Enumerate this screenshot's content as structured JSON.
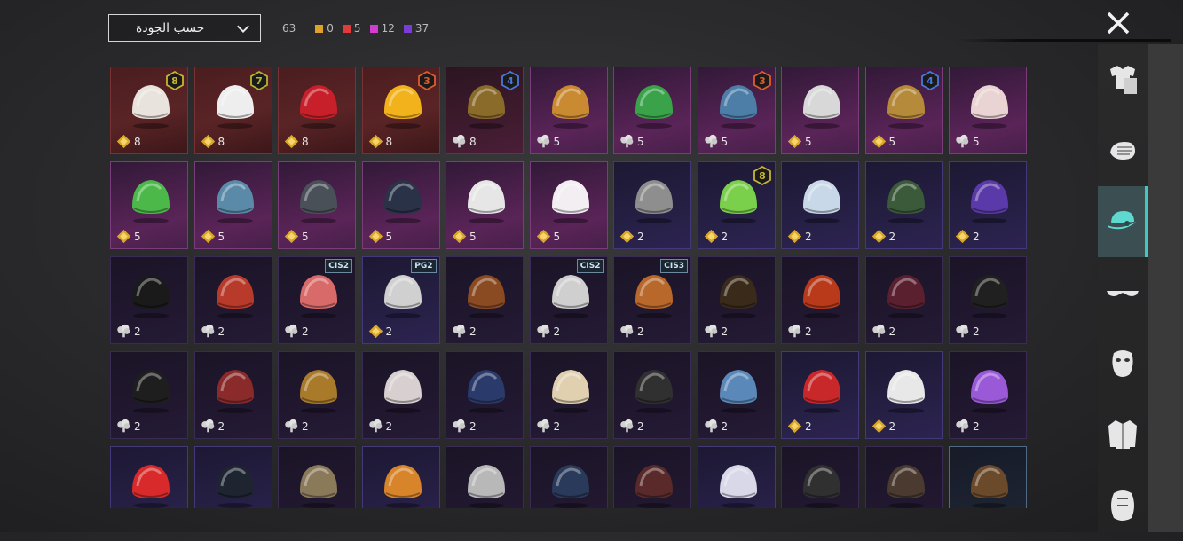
{
  "header": {
    "sort_label": "حسب الجودة",
    "total": "63",
    "stats": [
      {
        "color": "#e0a12a",
        "value": "0"
      },
      {
        "color": "#e03a3a",
        "value": "5"
      },
      {
        "color": "#d43cd0",
        "value": "12"
      },
      {
        "color": "#7a3cd8",
        "value": "37"
      }
    ]
  },
  "sidebar": {
    "items": [
      {
        "icon": "outfit-icon",
        "active": false
      },
      {
        "icon": "gloves-icon",
        "active": false
      },
      {
        "icon": "cap-icon",
        "active": true
      },
      {
        "icon": "glasses-icon",
        "active": false
      },
      {
        "icon": "mask-icon",
        "active": false
      },
      {
        "icon": "jacket-icon",
        "active": false
      },
      {
        "icon": "face-paint-icon",
        "active": false
      }
    ]
  },
  "items": [
    {
      "icon": "white-hair-icon",
      "count": "8",
      "currency": "gold",
      "rarity": "red",
      "badge": "8",
      "art": "#e8e3dc"
    },
    {
      "icon": "white-ponytail-icon",
      "count": "8",
      "currency": "gold",
      "rarity": "red",
      "badge": "7",
      "art": "#eeeeee"
    },
    {
      "icon": "red-helmet-icon",
      "count": "8",
      "currency": "gold",
      "rarity": "red",
      "art": "#c8202a"
    },
    {
      "icon": "fries-hat-icon",
      "count": "8",
      "currency": "gold",
      "rarity": "red",
      "badge": "3",
      "art": "#f2b21c"
    },
    {
      "icon": "gold-mask-helmet-icon",
      "count": "8",
      "currency": "silver",
      "rarity": "mix",
      "badge": "4",
      "art": "#8a6b2a"
    },
    {
      "icon": "fish-head-icon",
      "count": "5",
      "currency": "silver",
      "rarity": "pink",
      "art": "#c98a32"
    },
    {
      "icon": "green-demon-helmet-icon",
      "count": "5",
      "currency": "silver",
      "rarity": "pink",
      "art": "#3aa34a"
    },
    {
      "icon": "ufo-hat-icon",
      "count": "5",
      "currency": "silver",
      "rarity": "pink",
      "badge": "3",
      "art": "#4c7ea8"
    },
    {
      "icon": "robot-helmet-icon",
      "count": "5",
      "currency": "gold",
      "rarity": "pink",
      "art": "#d8d8d8"
    },
    {
      "icon": "samurai-mask-icon",
      "count": "5",
      "currency": "gold",
      "rarity": "pink",
      "badge": "4",
      "art": "#b58a3a"
    },
    {
      "icon": "skull-mask-icon",
      "count": "5",
      "currency": "silver",
      "rarity": "pink",
      "art": "#e9d3d3"
    },
    {
      "icon": "frog-hat-icon",
      "count": "5",
      "currency": "gold",
      "rarity": "pink",
      "art": "#4cb84a"
    },
    {
      "icon": "headband-icon",
      "count": "5",
      "currency": "gold",
      "rarity": "pink",
      "art": "#5a8aa8"
    },
    {
      "icon": "tactical-helmet-icon",
      "count": "5",
      "currency": "gold",
      "rarity": "pink",
      "art": "#4a5058"
    },
    {
      "icon": "cat-helmet-icon",
      "count": "5",
      "currency": "gold",
      "rarity": "pink",
      "art": "#2a3248"
    },
    {
      "icon": "beanie-icon",
      "count": "5",
      "currency": "gold",
      "rarity": "pink",
      "art": "#e6e6e6"
    },
    {
      "icon": "sun-hat-icon",
      "count": "5",
      "currency": "gold",
      "rarity": "pink",
      "art": "#f2eef2"
    },
    {
      "icon": "grey-wig-icon",
      "count": "2",
      "currency": "gold",
      "rarity": "purple",
      "art": "#8e8e8e"
    },
    {
      "icon": "green-skull-icon",
      "count": "2",
      "currency": "gold",
      "rarity": "purple",
      "badge": "8",
      "art": "#7ad04a"
    },
    {
      "icon": "baseball-cap-icon",
      "count": "2",
      "currency": "gold",
      "rarity": "purple",
      "art": "#c9d8e8"
    },
    {
      "icon": "gas-mask-helmet-icon",
      "count": "2",
      "currency": "gold",
      "rarity": "purple",
      "art": "#3a5a3a"
    },
    {
      "icon": "purple-helmet-icon",
      "count": "2",
      "currency": "gold",
      "rarity": "purple",
      "art": "#5a3aa8"
    },
    {
      "icon": "black-cap-icon",
      "count": "2",
      "currency": "silver",
      "rarity": "dark",
      "art": "#1a1a1a"
    },
    {
      "icon": "bucket-hat-icon",
      "count": "2",
      "currency": "silver",
      "rarity": "dark",
      "art": "#b83a2a"
    },
    {
      "icon": "knit-hat-icon",
      "count": "2",
      "currency": "silver",
      "rarity": "dark",
      "tag": "CIS2",
      "art": "#d86a6a"
    },
    {
      "icon": "silver-wig-icon",
      "count": "2",
      "currency": "gold",
      "rarity": "purple",
      "tag": "PG2",
      "art": "#d0d0d0"
    },
    {
      "icon": "brown-braids-icon",
      "count": "2",
      "currency": "silver",
      "rarity": "dark",
      "art": "#8a4a22"
    },
    {
      "icon": "chef-gas-mask-icon",
      "count": "2",
      "currency": "silver",
      "rarity": "dark",
      "tag": "CIS2",
      "art": "#cfcfcf"
    },
    {
      "icon": "steampunk-mask-icon",
      "count": "2",
      "currency": "silver",
      "rarity": "dark",
      "tag": "CIS3",
      "art": "#b8682a"
    },
    {
      "icon": "goggles-hat-icon",
      "count": "2",
      "currency": "silver",
      "rarity": "dark",
      "art": "#3a2a1a"
    },
    {
      "icon": "dreadlock-mask-icon",
      "count": "2",
      "currency": "silver",
      "rarity": "dark",
      "art": "#b83a1a"
    },
    {
      "icon": "witch-hat-icon",
      "count": "2",
      "currency": "silver",
      "rarity": "dark",
      "art": "#5a2030"
    },
    {
      "icon": "black-gas-mask-icon",
      "count": "2",
      "currency": "silver",
      "rarity": "dark",
      "art": "#202020"
    },
    {
      "icon": "top-hat-icon",
      "count": "2",
      "currency": "silver",
      "rarity": "dark",
      "art": "#1e1e1e"
    },
    {
      "icon": "pilot-goggles-icon",
      "count": "2",
      "currency": "silver",
      "rarity": "dark",
      "art": "#8a2a2a"
    },
    {
      "icon": "brown-beanie-icon",
      "count": "2",
      "currency": "silver",
      "rarity": "dark",
      "art": "#a87a2a"
    },
    {
      "icon": "clown-mask-icon",
      "count": "2",
      "currency": "silver",
      "rarity": "dark",
      "art": "#d8d0d0"
    },
    {
      "icon": "police-cap-icon",
      "count": "2",
      "currency": "silver",
      "rarity": "dark",
      "art": "#2a3a6a"
    },
    {
      "icon": "jester-mask-icon",
      "count": "2",
      "currency": "silver",
      "rarity": "dark",
      "art": "#e0d0b0"
    },
    {
      "icon": "balaclava-icon",
      "count": "2",
      "currency": "silver",
      "rarity": "dark",
      "art": "#303030"
    },
    {
      "icon": "shark-hat-icon",
      "count": "2",
      "currency": "silver",
      "rarity": "dark",
      "art": "#5a88b8"
    },
    {
      "icon": "beret-icon",
      "count": "2",
      "currency": "gold",
      "rarity": "purple",
      "art": "#c8282a"
    },
    {
      "icon": "white-shark-hat-icon",
      "count": "2",
      "currency": "gold",
      "rarity": "purple",
      "art": "#e8e8e8"
    },
    {
      "icon": "flower-crown-icon",
      "count": "2",
      "currency": "silver",
      "rarity": "dark",
      "art": "#9a5ad8"
    },
    {
      "icon": "red-bucket-hat-icon",
      "count": "",
      "currency": "",
      "rarity": "purple",
      "art": "#d82a2a"
    },
    {
      "icon": "officer-cap-icon",
      "count": "",
      "currency": "",
      "rarity": "purple",
      "art": "#1e2430"
    },
    {
      "icon": "wool-hat-icon",
      "count": "",
      "currency": "",
      "rarity": "dark",
      "art": "#8a7a5a"
    },
    {
      "icon": "burger-hat-icon",
      "count": "",
      "currency": "",
      "rarity": "purple",
      "art": "#d8842a"
    },
    {
      "icon": "headlamp-icon",
      "count": "",
      "currency": "",
      "rarity": "dark",
      "art": "#b8b8b8"
    },
    {
      "icon": "sailor-cap-icon",
      "count": "",
      "currency": "",
      "rarity": "dark",
      "art": "#2a3a5a"
    },
    {
      "icon": "fedora-icon",
      "count": "",
      "currency": "",
      "rarity": "dark",
      "art": "#5a2a2a"
    },
    {
      "icon": "net-cap-icon",
      "count": "",
      "currency": "",
      "rarity": "purple",
      "art": "#d8d8e8"
    },
    {
      "icon": "black-bucket-icon",
      "count": "",
      "currency": "",
      "rarity": "dark",
      "art": "#303030"
    },
    {
      "icon": "aviator-helmet-icon",
      "count": "",
      "currency": "",
      "rarity": "dark",
      "art": "#4a3a30"
    },
    {
      "icon": "brown-wig-icon",
      "count": "",
      "currency": "",
      "rarity": "blue",
      "art": "#6a4a2a"
    }
  ]
}
